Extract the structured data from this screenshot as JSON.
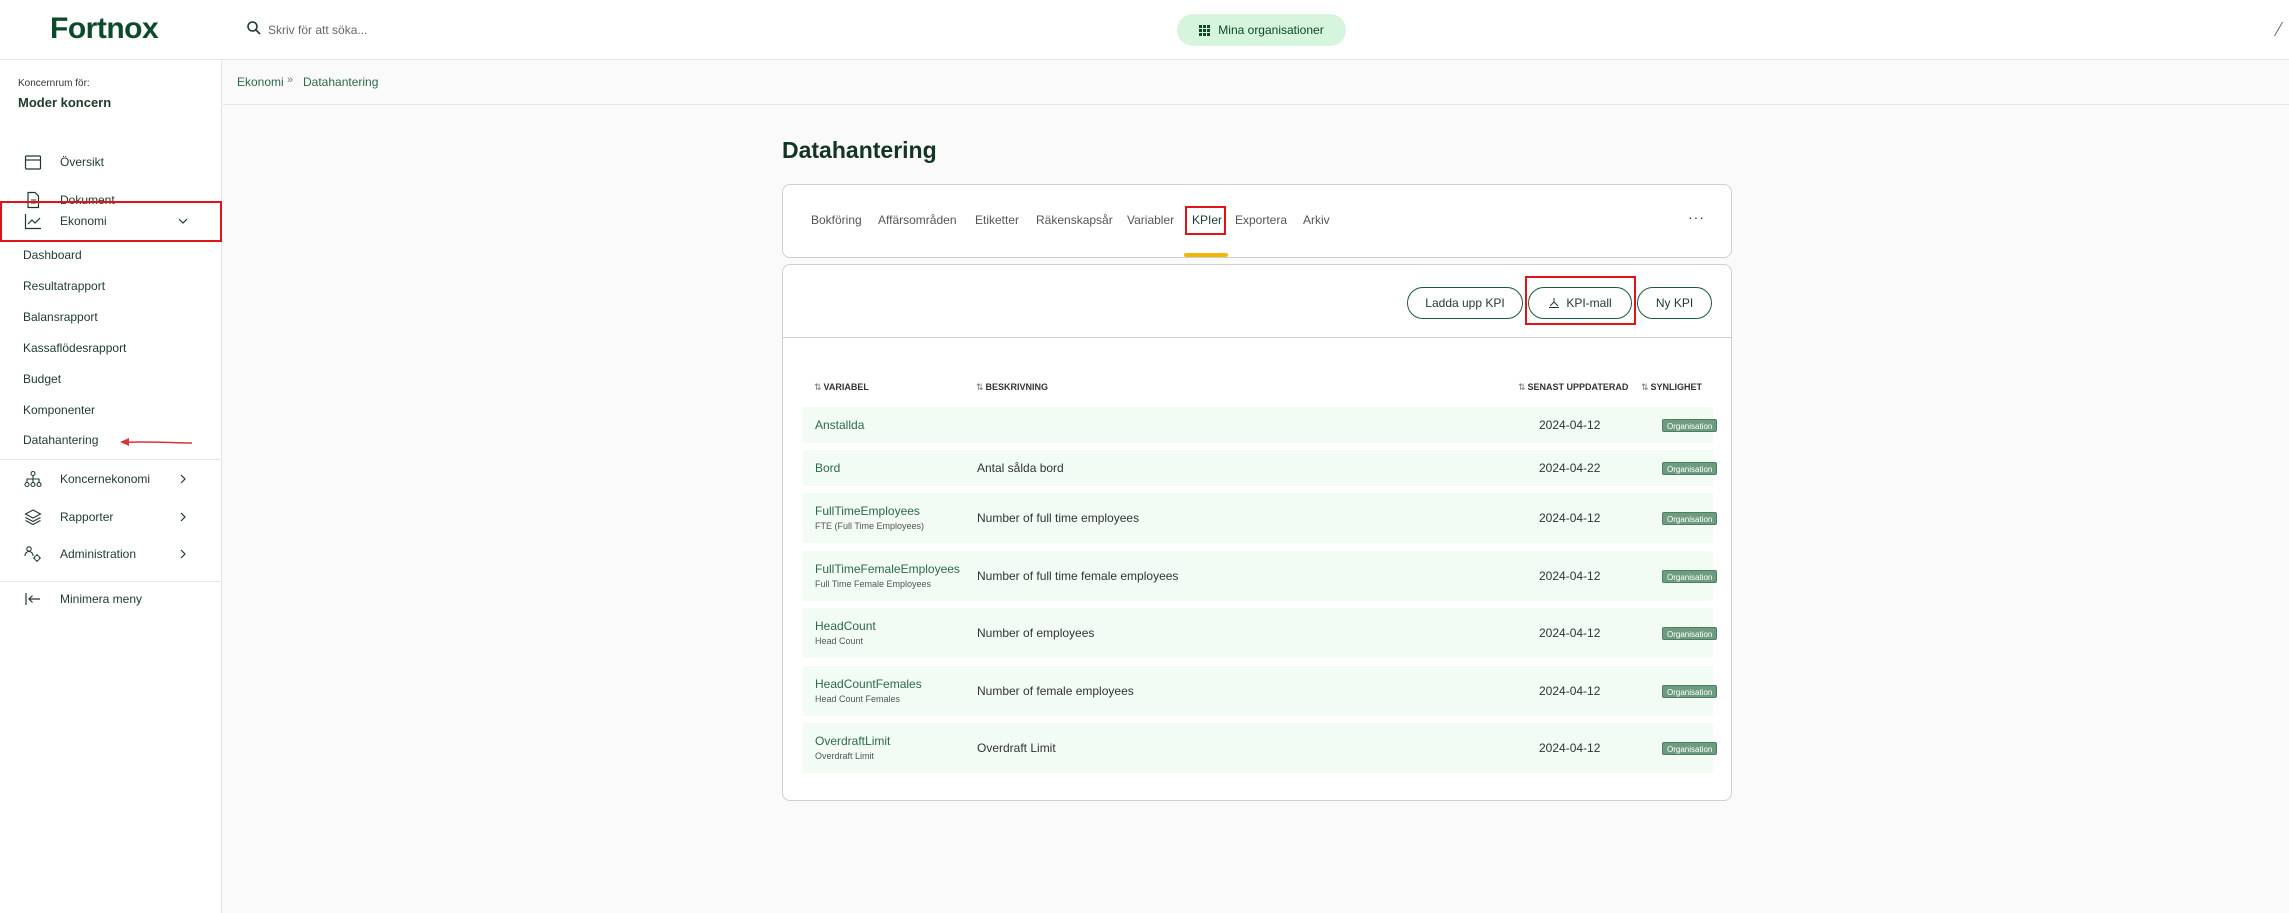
{
  "app": {
    "logo": "Fortnox",
    "search_placeholder": "Skriv för att söka...",
    "org_button_label": "Mina organisationer"
  },
  "sidebar": {
    "caption": "Koncernrum för:",
    "org_name": "Moder koncern",
    "items": [
      {
        "label": "Översikt",
        "icon": "calendar-icon"
      },
      {
        "label": "Dokument",
        "icon": "document-icon"
      },
      {
        "label": "Ekonomi",
        "icon": "chart-line-icon",
        "expanded": true
      }
    ],
    "sub_items": [
      "Dashboard",
      "Resultatrapport",
      "Balansrapport",
      "Kassaflödesrapport",
      "Budget",
      "Komponenter",
      "Datahantering"
    ],
    "groups": [
      {
        "label": "Koncernekonomi",
        "icon": "hierarchy-icon"
      },
      {
        "label": "Rapporter",
        "icon": "layers-icon"
      },
      {
        "label": "Administration",
        "icon": "users-gear-icon"
      }
    ],
    "minimize_label": "Minimera meny"
  },
  "breadcrumb": {
    "items": [
      "Ekonomi",
      "Datahantering"
    ],
    "separator": "»"
  },
  "page": {
    "title": "Datahantering",
    "tabs": [
      "Bokföring",
      "Affärsområden",
      "Etiketter",
      "Räkenskapsår",
      "Variabler",
      "KPIer",
      "Exportera",
      "Arkiv"
    ],
    "active_tab": "KPIer",
    "more_label": "···"
  },
  "toolbar": {
    "upload_label": "Ladda upp KPI",
    "template_label": "KPI-mall",
    "new_label": "Ny KPI"
  },
  "table": {
    "sort_glyph": "⇅",
    "headers": [
      "VARIABEL",
      "BESKRIVNING",
      "SENAST UPPDATERAD",
      "SYNLIGHET"
    ],
    "rows": [
      {
        "variable": "Anstallda",
        "sub": "",
        "description": "",
        "updated": "2024-04-12",
        "visibility": "Organisation"
      },
      {
        "variable": "Bord",
        "sub": "",
        "description": "Antal sålda bord",
        "updated": "2024-04-22",
        "visibility": "Organisation"
      },
      {
        "variable": "FullTimeEmployees",
        "sub": "FTE (Full Time Employees)",
        "description": "Number of full time employees",
        "updated": "2024-04-12",
        "visibility": "Organisation"
      },
      {
        "variable": "FullTimeFemaleEmployees",
        "sub": "Full Time Female Employees",
        "description": "Number of full time female employees",
        "updated": "2024-04-12",
        "visibility": "Organisation"
      },
      {
        "variable": "HeadCount",
        "sub": "Head Count",
        "description": "Number of employees",
        "updated": "2024-04-12",
        "visibility": "Organisation"
      },
      {
        "variable": "HeadCountFemales",
        "sub": "Head Count Females",
        "description": "Number of female employees",
        "updated": "2024-04-12",
        "visibility": "Organisation"
      },
      {
        "variable": "OverdraftLimit",
        "sub": "Overdraft Limit",
        "description": "Overdraft Limit",
        "updated": "2024-04-12",
        "visibility": "Organisation"
      }
    ]
  },
  "colors": {
    "brand": "#0d4a2b",
    "accent_tab": "#f2b705",
    "badge": "#6e9c80",
    "row_bg": "#f3fbf5",
    "highlight": "#e0121a"
  }
}
